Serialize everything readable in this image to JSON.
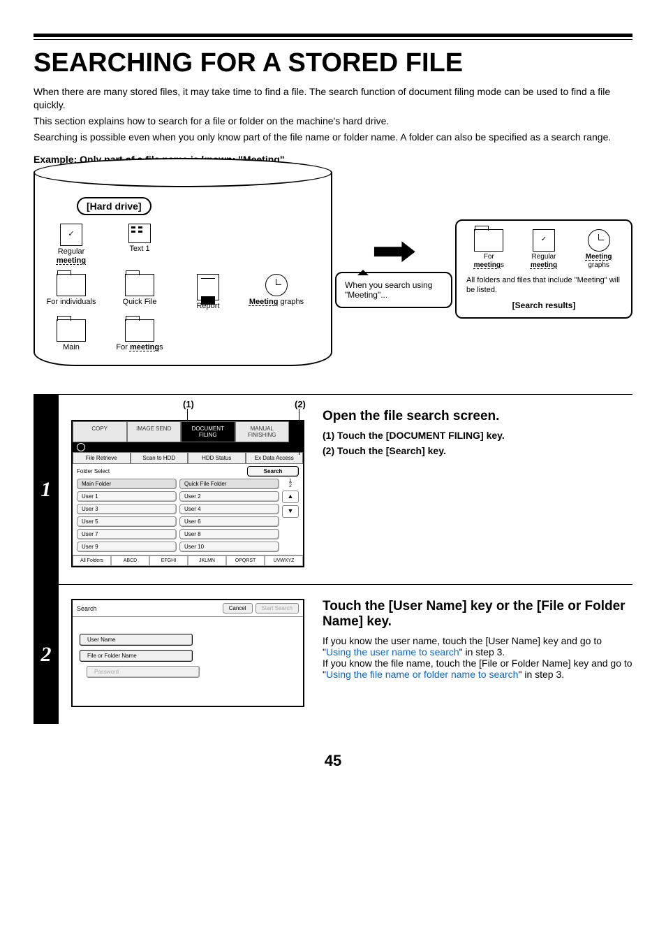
{
  "heading": "SEARCHING FOR A STORED FILE",
  "intro": {
    "p1": "When there are many stored files, it may take time to find a file. The search function of document filing mode can be used to find a file quickly.",
    "p2": "This section explains how to search for a file or folder on the machine's hard drive.",
    "p3": "Searching is possible even when you only know part of the file name or folder name. A folder can also be specified as a search range."
  },
  "example_label": "Example: Only part of a file name is known: \"Meeting\"",
  "diagram": {
    "hard_drive": "[Hard drive]",
    "items": {
      "regular_meeting_pre": "Regular ",
      "regular_meeting_bold": "meeting",
      "text1": "Text 1",
      "for_individuals": "For individuals",
      "quick_file": "Quick File",
      "report": "Report",
      "meeting_graphs_bold": "Meeting",
      "meeting_graphs_post": " graphs",
      "main": "Main",
      "for_pre": "For ",
      "for_bold": "meeting",
      "for_post": "s"
    },
    "callout_search": "When you search using \"Meeting\"...",
    "results": {
      "for_meetings_pre": "For",
      "for_meetings_bold": "meeting",
      "for_meetings_post": "s",
      "regular_pre": "Regular",
      "regular_bold": "meeting",
      "mg_bold": "Meeting",
      "mg_post": "graphs",
      "note": "All folders and files that include \"Meeting\" will be listed.",
      "title": "[Search results]"
    }
  },
  "step1": {
    "num": "1",
    "callouts": {
      "c1": "(1)",
      "c2": "(2)"
    },
    "tabs": {
      "copy": "COPY",
      "image_send": "IMAGE SEND",
      "doc_filing": "DOCUMENT FILING",
      "manual": "MANUAL FINISHING"
    },
    "sub": {
      "file_retrieve": "File Retrieve",
      "scan_hdd": "Scan to HDD",
      "hdd_status": "HDD Status",
      "ex_data": "Ex Data Access"
    },
    "folder_select": "Folder Select",
    "search": "Search",
    "main_folder": "Main Folder",
    "quick_folder": "Quick File Folder",
    "users": [
      "User 1",
      "User 2",
      "User 3",
      "User 4",
      "User 5",
      "User 6",
      "User 7",
      "User 8",
      "User 9",
      "User 10"
    ],
    "page_ind": {
      "top": "1",
      "bot": "2"
    },
    "alpha": [
      "All Folders",
      "ABCD",
      "EFGHI",
      "JKLMN",
      "OPQRST",
      "UVWXYZ"
    ],
    "desc_h": "Open the file search screen.",
    "desc_1": "(1)  Touch the [DOCUMENT FILING] key.",
    "desc_2": "(2)  Touch the [Search] key."
  },
  "step2": {
    "num": "2",
    "title": "Search",
    "cancel": "Cancel",
    "start": "Start Search",
    "fields": {
      "user": "User Name",
      "file": "File or Folder Name",
      "pass": "Password"
    },
    "desc_h": "Touch the [User Name] key or the [File or Folder Name] key.",
    "p1a": "If you know the user name, touch the [User Name] key and go to \"",
    "p1link": "Using the user name to search",
    "p1b": "\" in step 3.",
    "p2a": "If you know the file name, touch the [File or Folder Name] key and go to \"",
    "p2link": "Using the file name or folder name to search",
    "p2b": "\" in step 3."
  },
  "page_number": "45"
}
